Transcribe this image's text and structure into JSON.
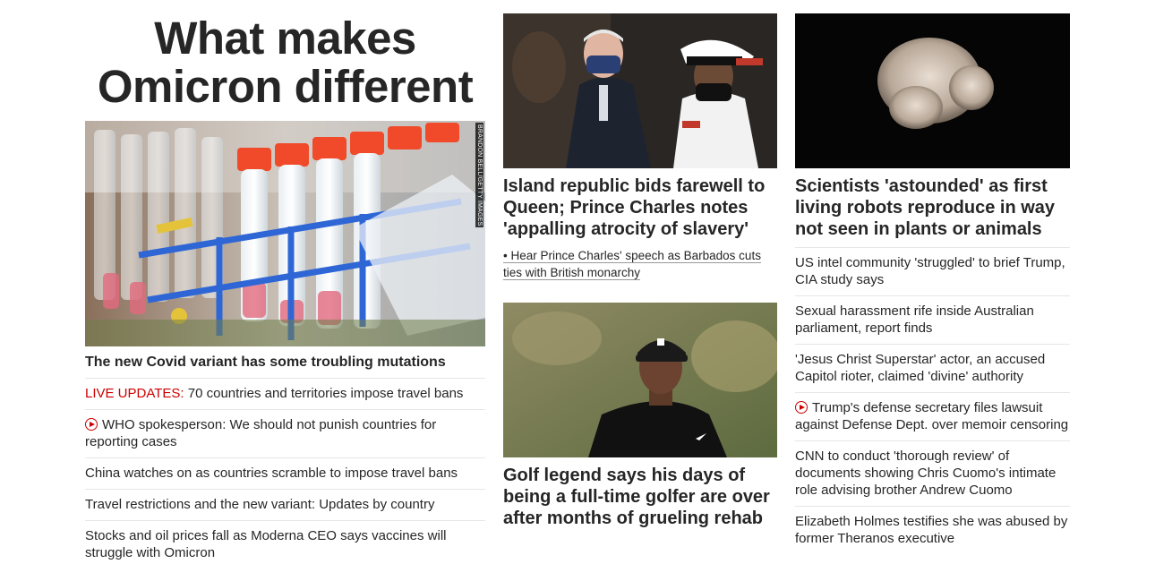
{
  "feature": {
    "title": "What makes Omicron different",
    "photo_credit": "BRANDON BELL/GETTY IMAGES",
    "lead_headline": "The new Covid variant has some troubling mutations",
    "stories": [
      {
        "prefix": "LIVE UPDATES:",
        "text": " 70 countries and territories impose travel bans"
      },
      {
        "video": true,
        "text": "WHO spokesperson: We should not punish countries for reporting cases"
      },
      {
        "text": "China watches on as countries scramble to impose travel bans"
      },
      {
        "text": "Travel restrictions and the new variant: Updates by country"
      },
      {
        "text": "Stocks and oil prices fall as Moderna CEO says vaccines will struggle with Omicron"
      }
    ]
  },
  "middle": {
    "card1": {
      "headline": "Island republic bids farewell to Queen; Prince Charles notes 'appalling atrocity of slavery'",
      "sub": "• Hear Prince Charles' speech as Barbados cuts ties with British monarchy"
    },
    "card2": {
      "headline": "Golf legend says his days of being a full-time golfer are over after months of grueling rehab"
    }
  },
  "right": {
    "card": {
      "headline": "Scientists 'astounded' as first living robots reproduce in way not seen in plants or animals"
    },
    "stories": [
      {
        "text": "US intel community 'struggled' to brief Trump, CIA study says"
      },
      {
        "text": "Sexual harassment rife inside Australian parliament, report finds"
      },
      {
        "text": "'Jesus Christ Superstar' actor, an accused Capitol rioter, claimed 'divine' authority"
      },
      {
        "video": true,
        "text": "Trump's defense secretary files lawsuit against Defense Dept. over memoir censoring"
      },
      {
        "text": "CNN to conduct 'thorough review' of documents showing Chris Cuomo's intimate role advising brother Andrew Cuomo"
      },
      {
        "text": "Elizabeth Holmes testifies she was abused by former Theranos executive"
      }
    ]
  },
  "colors": {
    "text": "#262626",
    "live_red": "#cc0000",
    "divider": "#e6e6e6"
  }
}
